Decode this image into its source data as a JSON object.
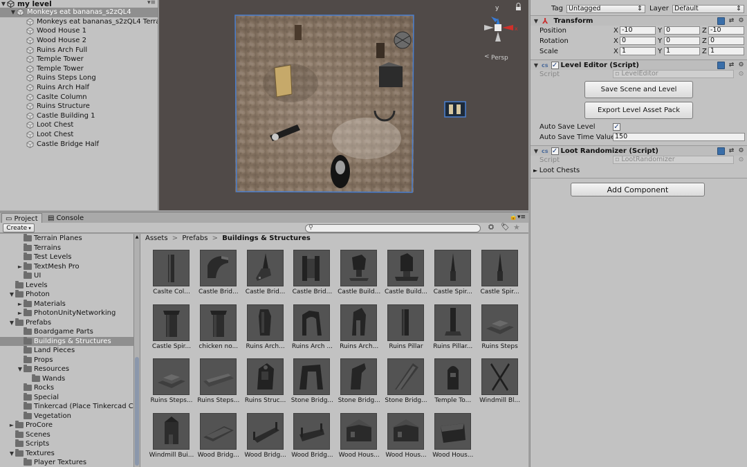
{
  "hierarchy": {
    "title": "my level",
    "items": [
      {
        "label": "Monkeys eat bananas_s2zQL4",
        "selected": true
      },
      {
        "label": "Monkeys eat bananas_s2zQL4 Terra"
      },
      {
        "label": "Wood House 1"
      },
      {
        "label": "Wood House 2"
      },
      {
        "label": "Ruins Arch Full"
      },
      {
        "label": "Temple Tower"
      },
      {
        "label": "Temple Tower"
      },
      {
        "label": "Ruins Steps Long"
      },
      {
        "label": "Ruins Arch Half"
      },
      {
        "label": "Caslte Column"
      },
      {
        "label": "Ruins Structure"
      },
      {
        "label": "Castle Building 1"
      },
      {
        "label": "Loot Chest"
      },
      {
        "label": "Loot Chest"
      },
      {
        "label": "Castle Bridge Half"
      }
    ]
  },
  "scene": {
    "persp_label": "Persp",
    "gizmo_y": "y",
    "lock_icon": "lock-icon"
  },
  "inspector": {
    "tag_label": "Tag",
    "tag_value": "Untagged",
    "layer_label": "Layer",
    "layer_value": "Default",
    "transform": {
      "title": "Transform",
      "position_label": "Position",
      "rotation_label": "Rotation",
      "scale_label": "Scale",
      "x": "X",
      "y": "Y",
      "z": "Z",
      "position": [
        "-10",
        "0",
        "-10"
      ],
      "rotation": [
        "0",
        "0",
        "0"
      ],
      "scale": [
        "1",
        "1",
        "1"
      ]
    },
    "level_editor": {
      "title": "Level Editor (Script)",
      "script_label": "Script",
      "script_value": "LevelEditor",
      "save_button": "Save Scene and Level",
      "export_button": "Export Level Asset Pack",
      "auto_save_label": "Auto Save Level",
      "auto_save_checked": true,
      "auto_save_time_label": "Auto Save Time Value",
      "auto_save_time_value": "150"
    },
    "loot_randomizer": {
      "title": "Loot Randomizer (Script)",
      "script_label": "Script",
      "script_value": "LootRandomizer",
      "loot_chests_label": "Loot Chests"
    },
    "add_component": "Add Component"
  },
  "bottom": {
    "project_tab": "Project",
    "console_tab": "Console",
    "create_button": "Create",
    "search_placeholder": "",
    "breadcrumb": [
      "Assets",
      "Prefabs",
      "Buildings & Structures"
    ]
  },
  "folders": [
    {
      "label": "Terrain Planes",
      "indent": 2,
      "arrow": ""
    },
    {
      "label": "Terrains",
      "indent": 2,
      "arrow": ""
    },
    {
      "label": "Test Levels",
      "indent": 2,
      "arrow": ""
    },
    {
      "label": "TextMesh Pro",
      "indent": 2,
      "arrow": "►"
    },
    {
      "label": "UI",
      "indent": 2,
      "arrow": ""
    },
    {
      "label": "Levels",
      "indent": 1,
      "arrow": ""
    },
    {
      "label": "Photon",
      "indent": 1,
      "arrow": "▼"
    },
    {
      "label": "Materials",
      "indent": 2,
      "arrow": "►"
    },
    {
      "label": "PhotonUnityNetworking",
      "indent": 2,
      "arrow": "►"
    },
    {
      "label": "Prefabs",
      "indent": 1,
      "arrow": "▼"
    },
    {
      "label": "Boardgame Parts",
      "indent": 2,
      "arrow": ""
    },
    {
      "label": "Buildings & Structures",
      "indent": 2,
      "arrow": "",
      "selected": true
    },
    {
      "label": "Land Pieces",
      "indent": 2,
      "arrow": ""
    },
    {
      "label": "Props",
      "indent": 2,
      "arrow": ""
    },
    {
      "label": "Resources",
      "indent": 2,
      "arrow": "▼"
    },
    {
      "label": "Wands",
      "indent": 3,
      "arrow": ""
    },
    {
      "label": "Rocks",
      "indent": 2,
      "arrow": ""
    },
    {
      "label": "Special",
      "indent": 2,
      "arrow": ""
    },
    {
      "label": "Tinkercad (Place Tinkercad C",
      "indent": 2,
      "arrow": ""
    },
    {
      "label": "Vegetation",
      "indent": 2,
      "arrow": ""
    },
    {
      "label": "ProCore",
      "indent": 1,
      "arrow": "►"
    },
    {
      "label": "Scenes",
      "indent": 1,
      "arrow": ""
    },
    {
      "label": "Scripts",
      "indent": 1,
      "arrow": ""
    },
    {
      "label": "Textures",
      "indent": 1,
      "arrow": "▼"
    },
    {
      "label": "Player Textures",
      "indent": 2,
      "arrow": ""
    }
  ],
  "assets": [
    {
      "label": "Caslte Col...",
      "shape": "column"
    },
    {
      "label": "Castle Brid...",
      "shape": "bridge"
    },
    {
      "label": "Castle Brid...",
      "shape": "spire-ramp"
    },
    {
      "label": "Castle Brid...",
      "shape": "gate"
    },
    {
      "label": "Castle Build...",
      "shape": "building"
    },
    {
      "label": "Castle Build...",
      "shape": "building2"
    },
    {
      "label": "Castle Spir...",
      "shape": "spire"
    },
    {
      "label": "Castle Spir...",
      "shape": "spire"
    },
    {
      "label": "Castle Spir...",
      "shape": "tower"
    },
    {
      "label": "chicken no...",
      "shape": "tower"
    },
    {
      "label": "Ruins Arch...",
      "shape": "ruin"
    },
    {
      "label": "Ruins Arch ...",
      "shape": "arch"
    },
    {
      "label": "Ruins Arch...",
      "shape": "arch2"
    },
    {
      "label": "Ruins Pillar",
      "shape": "pillar"
    },
    {
      "label": "Ruins Pillar...",
      "shape": "pillar2"
    },
    {
      "label": "Ruins Steps",
      "shape": "steps"
    },
    {
      "label": "Ruins Steps...",
      "shape": "steps"
    },
    {
      "label": "Ruins Steps...",
      "shape": "steps-long"
    },
    {
      "label": "Ruins Struc...",
      "shape": "structure"
    },
    {
      "label": "Stone Bridg...",
      "shape": "stone-bridge"
    },
    {
      "label": "Stone Bridg...",
      "shape": "stone-bridge2"
    },
    {
      "label": "Stone Bridg...",
      "shape": "ramp"
    },
    {
      "label": "Temple To...",
      "shape": "temple"
    },
    {
      "label": "Windmill Bl...",
      "shape": "blades"
    },
    {
      "label": "Windmill Bui...",
      "shape": "windmill"
    },
    {
      "label": "Wood Bridg...",
      "shape": "plank"
    },
    {
      "label": "Wood Bridg...",
      "shape": "wood-bridge"
    },
    {
      "label": "Wood Bridg...",
      "shape": "wood-bridge2"
    },
    {
      "label": "Wood Hous...",
      "shape": "house"
    },
    {
      "label": "Wood Hous...",
      "shape": "house"
    },
    {
      "label": "Wood Hous...",
      "shape": "chest"
    }
  ],
  "colors": {
    "panel": "#c2c2c2",
    "selection": "#8f8f8f",
    "scene_bg": "#504a48",
    "terrain": "#8a7866",
    "gizmo_x": "#d0302a",
    "gizmo_y": "#2f7bd6",
    "gizmo_z": "#3a7ad4"
  }
}
